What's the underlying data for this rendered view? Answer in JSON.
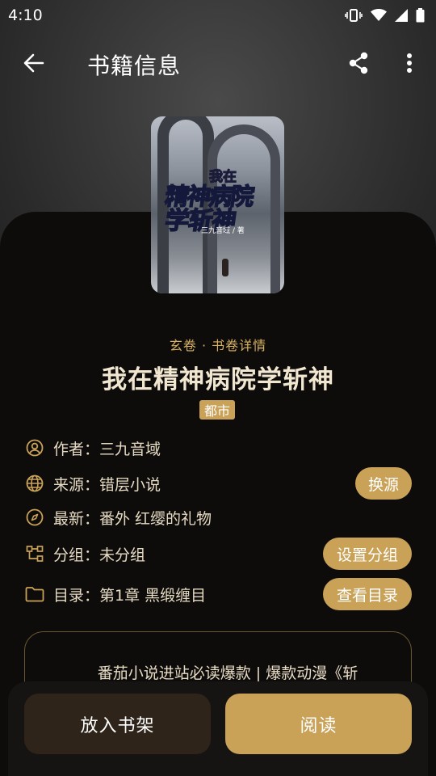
{
  "status_bar": {
    "time": "4:10"
  },
  "app_bar": {
    "title": "书籍信息"
  },
  "cover": {
    "small_title": "我在",
    "line1": "精神病院",
    "line2": "学斩神",
    "author_credit": "三九音域 / 著"
  },
  "book": {
    "kicker": "玄卷 · 书卷详情",
    "title": "我在精神病院学斩神",
    "genre": "都市"
  },
  "info": {
    "author": "作者：三九音域",
    "source": "来源：错层小说",
    "latest": "最新：番外 红缨的礼物",
    "group": "分组：未分组",
    "toc": "目录：第1章 黑缎缠目"
  },
  "actions": {
    "change_source": "换源",
    "set_group": "设置分组",
    "view_toc": "查看目录"
  },
  "intro": {
    "text": "番茄小说进站必读爆款 | 爆款动漫《斩"
  },
  "bottom": {
    "add_to_shelf": "放入书架",
    "read": "阅读"
  },
  "colors": {
    "accent": "#c9a258",
    "card_bg": "#0d0c0b",
    "text": "#e6dac3"
  }
}
